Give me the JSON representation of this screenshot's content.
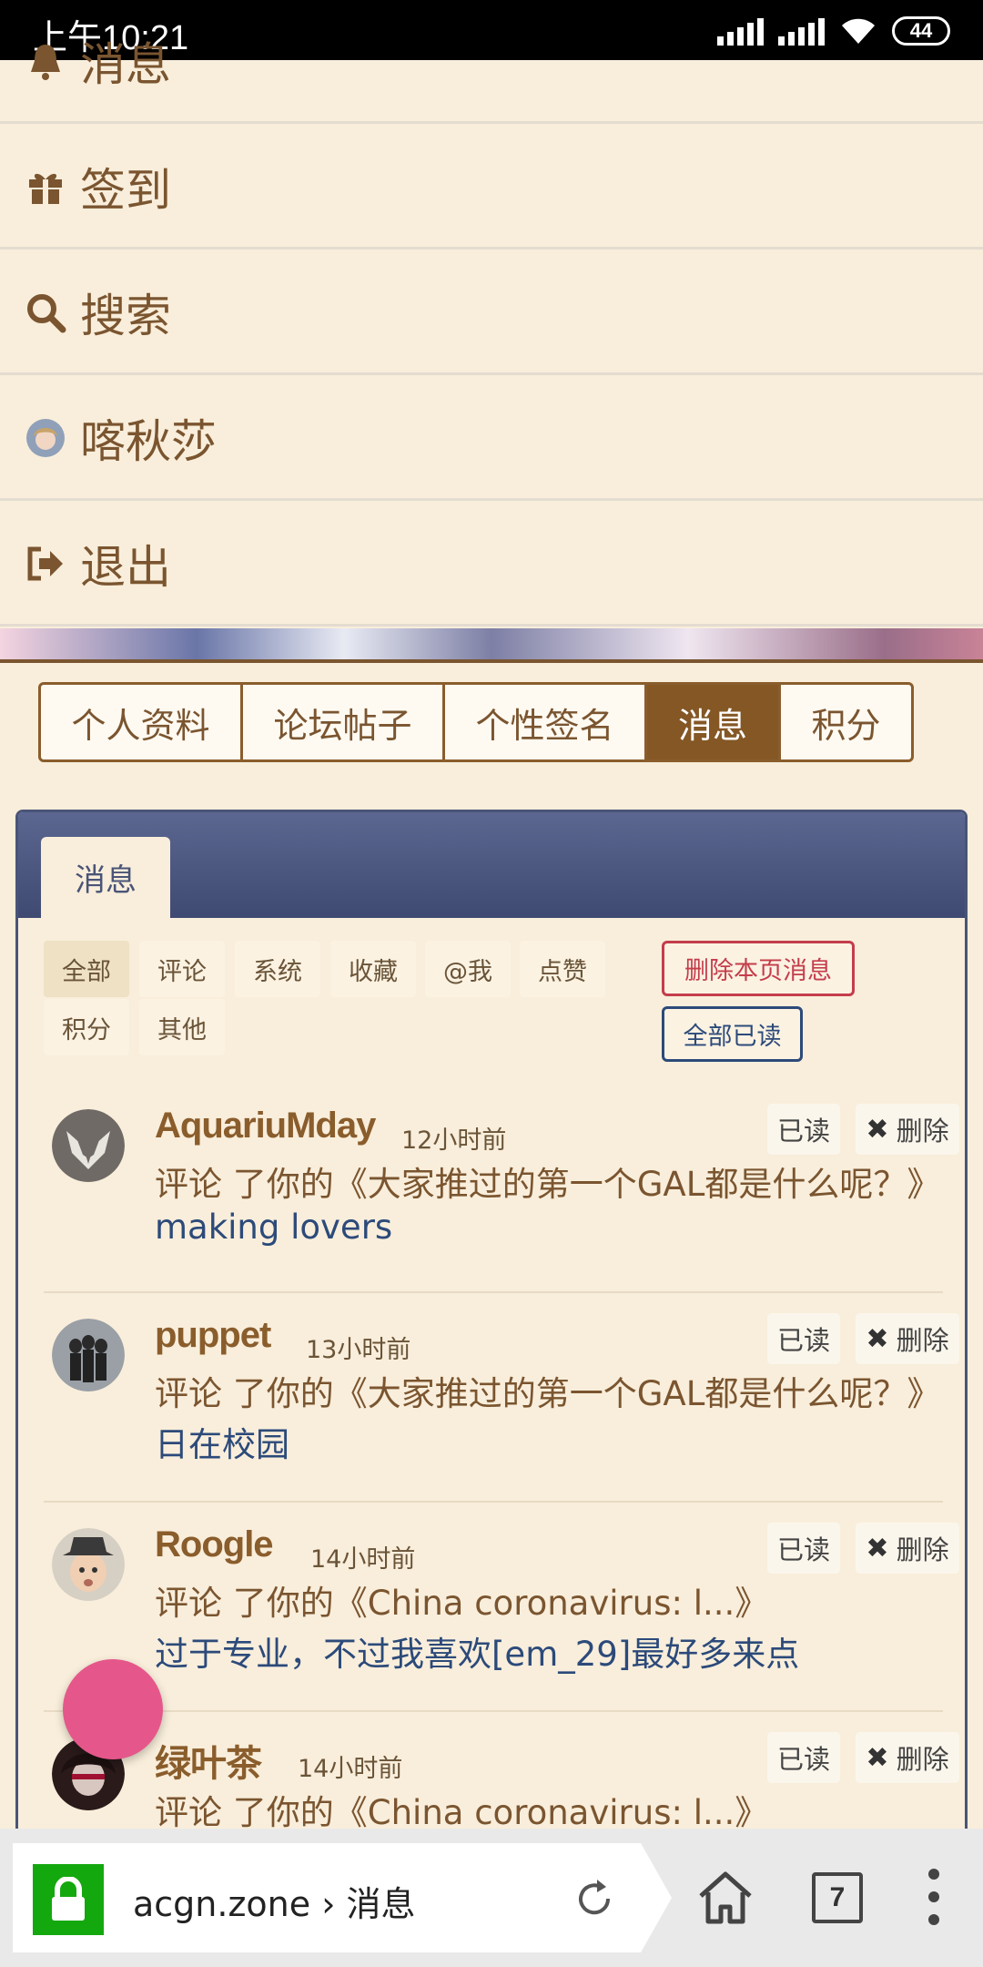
{
  "status_bar": {
    "time": "上午10:21",
    "battery": "44"
  },
  "menu": {
    "items": [
      {
        "label": "消息",
        "icon": "bell-icon"
      },
      {
        "label": "签到",
        "icon": "gift-icon"
      },
      {
        "label": "搜索",
        "icon": "search-icon"
      },
      {
        "label": "喀秋莎",
        "icon": "avatar"
      },
      {
        "label": "退出",
        "icon": "sign-out-icon"
      }
    ]
  },
  "profile_tabs": [
    {
      "label": "个人资料",
      "active": false
    },
    {
      "label": "论坛帖子",
      "active": false
    },
    {
      "label": "个性签名",
      "active": false
    },
    {
      "label": "消息",
      "active": true
    },
    {
      "label": "积分",
      "active": false
    }
  ],
  "panel": {
    "tab_label": "消息",
    "filters": [
      "全部",
      "评论",
      "系统",
      "收藏",
      "@我",
      "点赞",
      "积分",
      "其他"
    ],
    "active_filter": "全部",
    "delete_page_label": "删除本页消息",
    "mark_all_read_label": "全部已读",
    "read_label": "已读",
    "delete_label": "删除",
    "messages": [
      {
        "user": "AquariuMday",
        "time": "12小时前",
        "line": "评论 了你的《大家推过的第一个GAL都是什么呢？》",
        "content": "making lovers"
      },
      {
        "user": "puppet",
        "time": "13小时前",
        "line": "评论 了你的《大家推过的第一个GAL都是什么呢？》",
        "content": "日在校园"
      },
      {
        "user": "Roogle",
        "time": "14小时前",
        "line": "评论 了你的《China coronavirus: l...》",
        "content": "过于专业，不过我喜欢[em_29]最好多来点"
      },
      {
        "user": "绿叶茶",
        "time": "14小时前",
        "line": "评论 了你的《China coronavirus: l...》",
        "content": ""
      }
    ]
  },
  "browser": {
    "url": "acgn.zone › 消息",
    "tab_count": "7"
  },
  "colors": {
    "accent": "#845725",
    "background": "#f9eedb",
    "panel_header": "#4a5478",
    "danger": "#c43d4b",
    "link": "#2c4a7a",
    "fab": "#e5578a"
  }
}
